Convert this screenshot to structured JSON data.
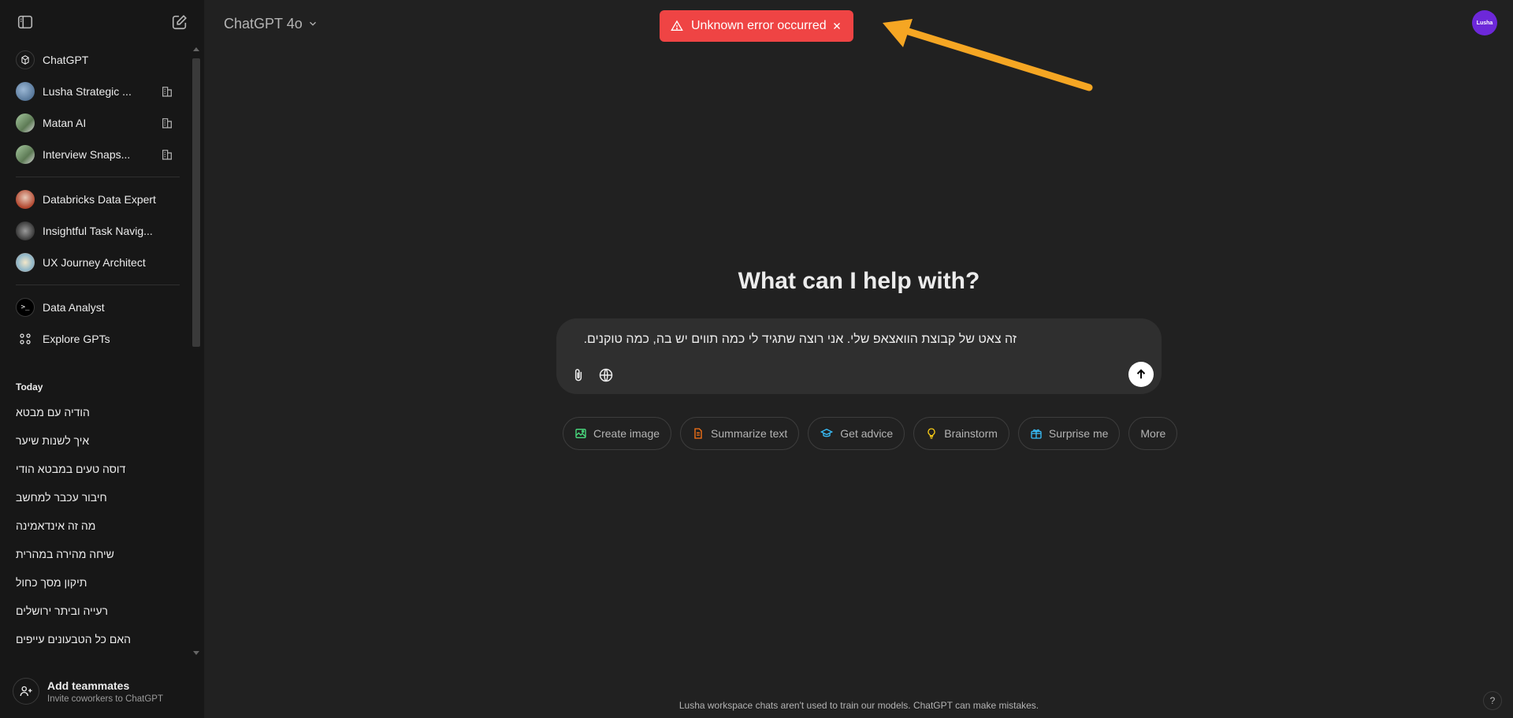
{
  "header": {
    "model_name": "ChatGPT 4o"
  },
  "toast": {
    "message": "Unknown error occurred",
    "color": "#ef4444"
  },
  "profile": {
    "label": "Lusha",
    "color": "#6d28d9"
  },
  "sidebar": {
    "gpts": [
      {
        "label": "ChatGPT",
        "icon": "chatgpt-logo-icon",
        "pinned": false
      },
      {
        "label": "Lusha Strategic ...",
        "icon": "avatar-icon",
        "pinned": true
      },
      {
        "label": "Matan AI",
        "icon": "avatar-icon",
        "pinned": true
      },
      {
        "label": "Interview Snaps...",
        "icon": "avatar-icon",
        "pinned": true
      }
    ],
    "gpts_more": [
      {
        "label": "Databricks Data Expert",
        "icon": "avatar-icon"
      },
      {
        "label": "Insightful Task Navig...",
        "icon": "avatar-icon"
      },
      {
        "label": "UX Journey Architect",
        "icon": "avatar-icon"
      }
    ],
    "tools": [
      {
        "label": "Data Analyst",
        "icon": "terminal-icon"
      },
      {
        "label": "Explore GPTs",
        "icon": "grid-icon"
      }
    ],
    "today_label": "Today",
    "chats": [
      "הודיה עם מבטא",
      "איך לשנות שיער",
      "דוסה טעים במבטא הודי",
      "חיבור עכבר למחשב",
      "מה זה אינדאמינה",
      "שיחה מהירה במהרית",
      "תיקון מסך כחול",
      "רעייה וביתר ירושלים",
      "האם כל הטבעונים עייפים"
    ],
    "add_teammates": {
      "title": "Add teammates",
      "subtitle": "Invite coworkers to ChatGPT"
    }
  },
  "main": {
    "heading": "What can I help with?",
    "composer_text": "זה צאט של קבוצת הוואצאפ שלי. אני רוצה שתגיד לי כמה תווים יש בה, כמה טוקנים.",
    "chips": [
      {
        "label": "Create image",
        "icon": "image-icon",
        "color": "#4ade80"
      },
      {
        "label": "Summarize text",
        "icon": "document-icon",
        "color": "#f97316"
      },
      {
        "label": "Get advice",
        "icon": "graduation-cap-icon",
        "color": "#38bdf8"
      },
      {
        "label": "Brainstorm",
        "icon": "lightbulb-icon",
        "color": "#facc15"
      },
      {
        "label": "Surprise me",
        "icon": "gift-icon",
        "color": "#38bdf8"
      },
      {
        "label": "More",
        "icon": "",
        "color": ""
      }
    ]
  },
  "footer": {
    "text": "Lusha workspace chats aren't used to train our models. ChatGPT can make mistakes.",
    "help": "?"
  }
}
